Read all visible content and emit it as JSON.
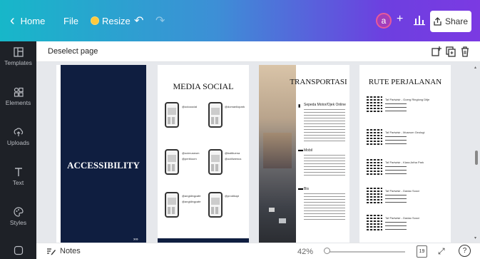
{
  "topbar": {
    "home": "Home",
    "file": "File",
    "resize": "Resize",
    "avatar": "a",
    "share": "Share"
  },
  "sidebar": {
    "items": [
      {
        "label": "Templates",
        "icon": "templates-icon"
      },
      {
        "label": "Elements",
        "icon": "elements-icon"
      },
      {
        "label": "Uploads",
        "icon": "uploads-icon"
      },
      {
        "label": "Text",
        "icon": "text-icon"
      },
      {
        "label": "Styles",
        "icon": "styles-icon"
      }
    ]
  },
  "header": {
    "deselect": "Deselect page"
  },
  "pages": {
    "p1": {
      "title": "ACCESSIBILITY",
      "bg": "#0f1e40"
    },
    "p2": {
      "title": "MEDIA SOCIAL",
      "handles": [
        "@odooocial",
        "@domanliopark",
        "@ocimuseum",
        "@perbloom",
        "@baitiluena",
        "@ociiliwenus",
        "@angklingcafe",
        "@angklingcafe",
        "@prodikopi"
      ]
    },
    "p3": {
      "title": "TRANSPORTASI",
      "modes": [
        "Sepeda Motor/Ojek Online",
        "Mobil",
        "Bis"
      ]
    },
    "p4": {
      "title": "RUTE PERJALANAN",
      "routes": [
        "Taf Pariwisir - Goerg Ringlong Ditje",
        "Taf Pariwisir - Museum Geologi",
        "Taf Pariwisir - Kiara Artha Park",
        "Taf Pariwisir - Dadao Sooci",
        "Taf Pariwisir - Dadao Sooci"
      ]
    }
  },
  "bottom": {
    "notes": "Notes",
    "zoom": "42%",
    "page_count": "19"
  }
}
